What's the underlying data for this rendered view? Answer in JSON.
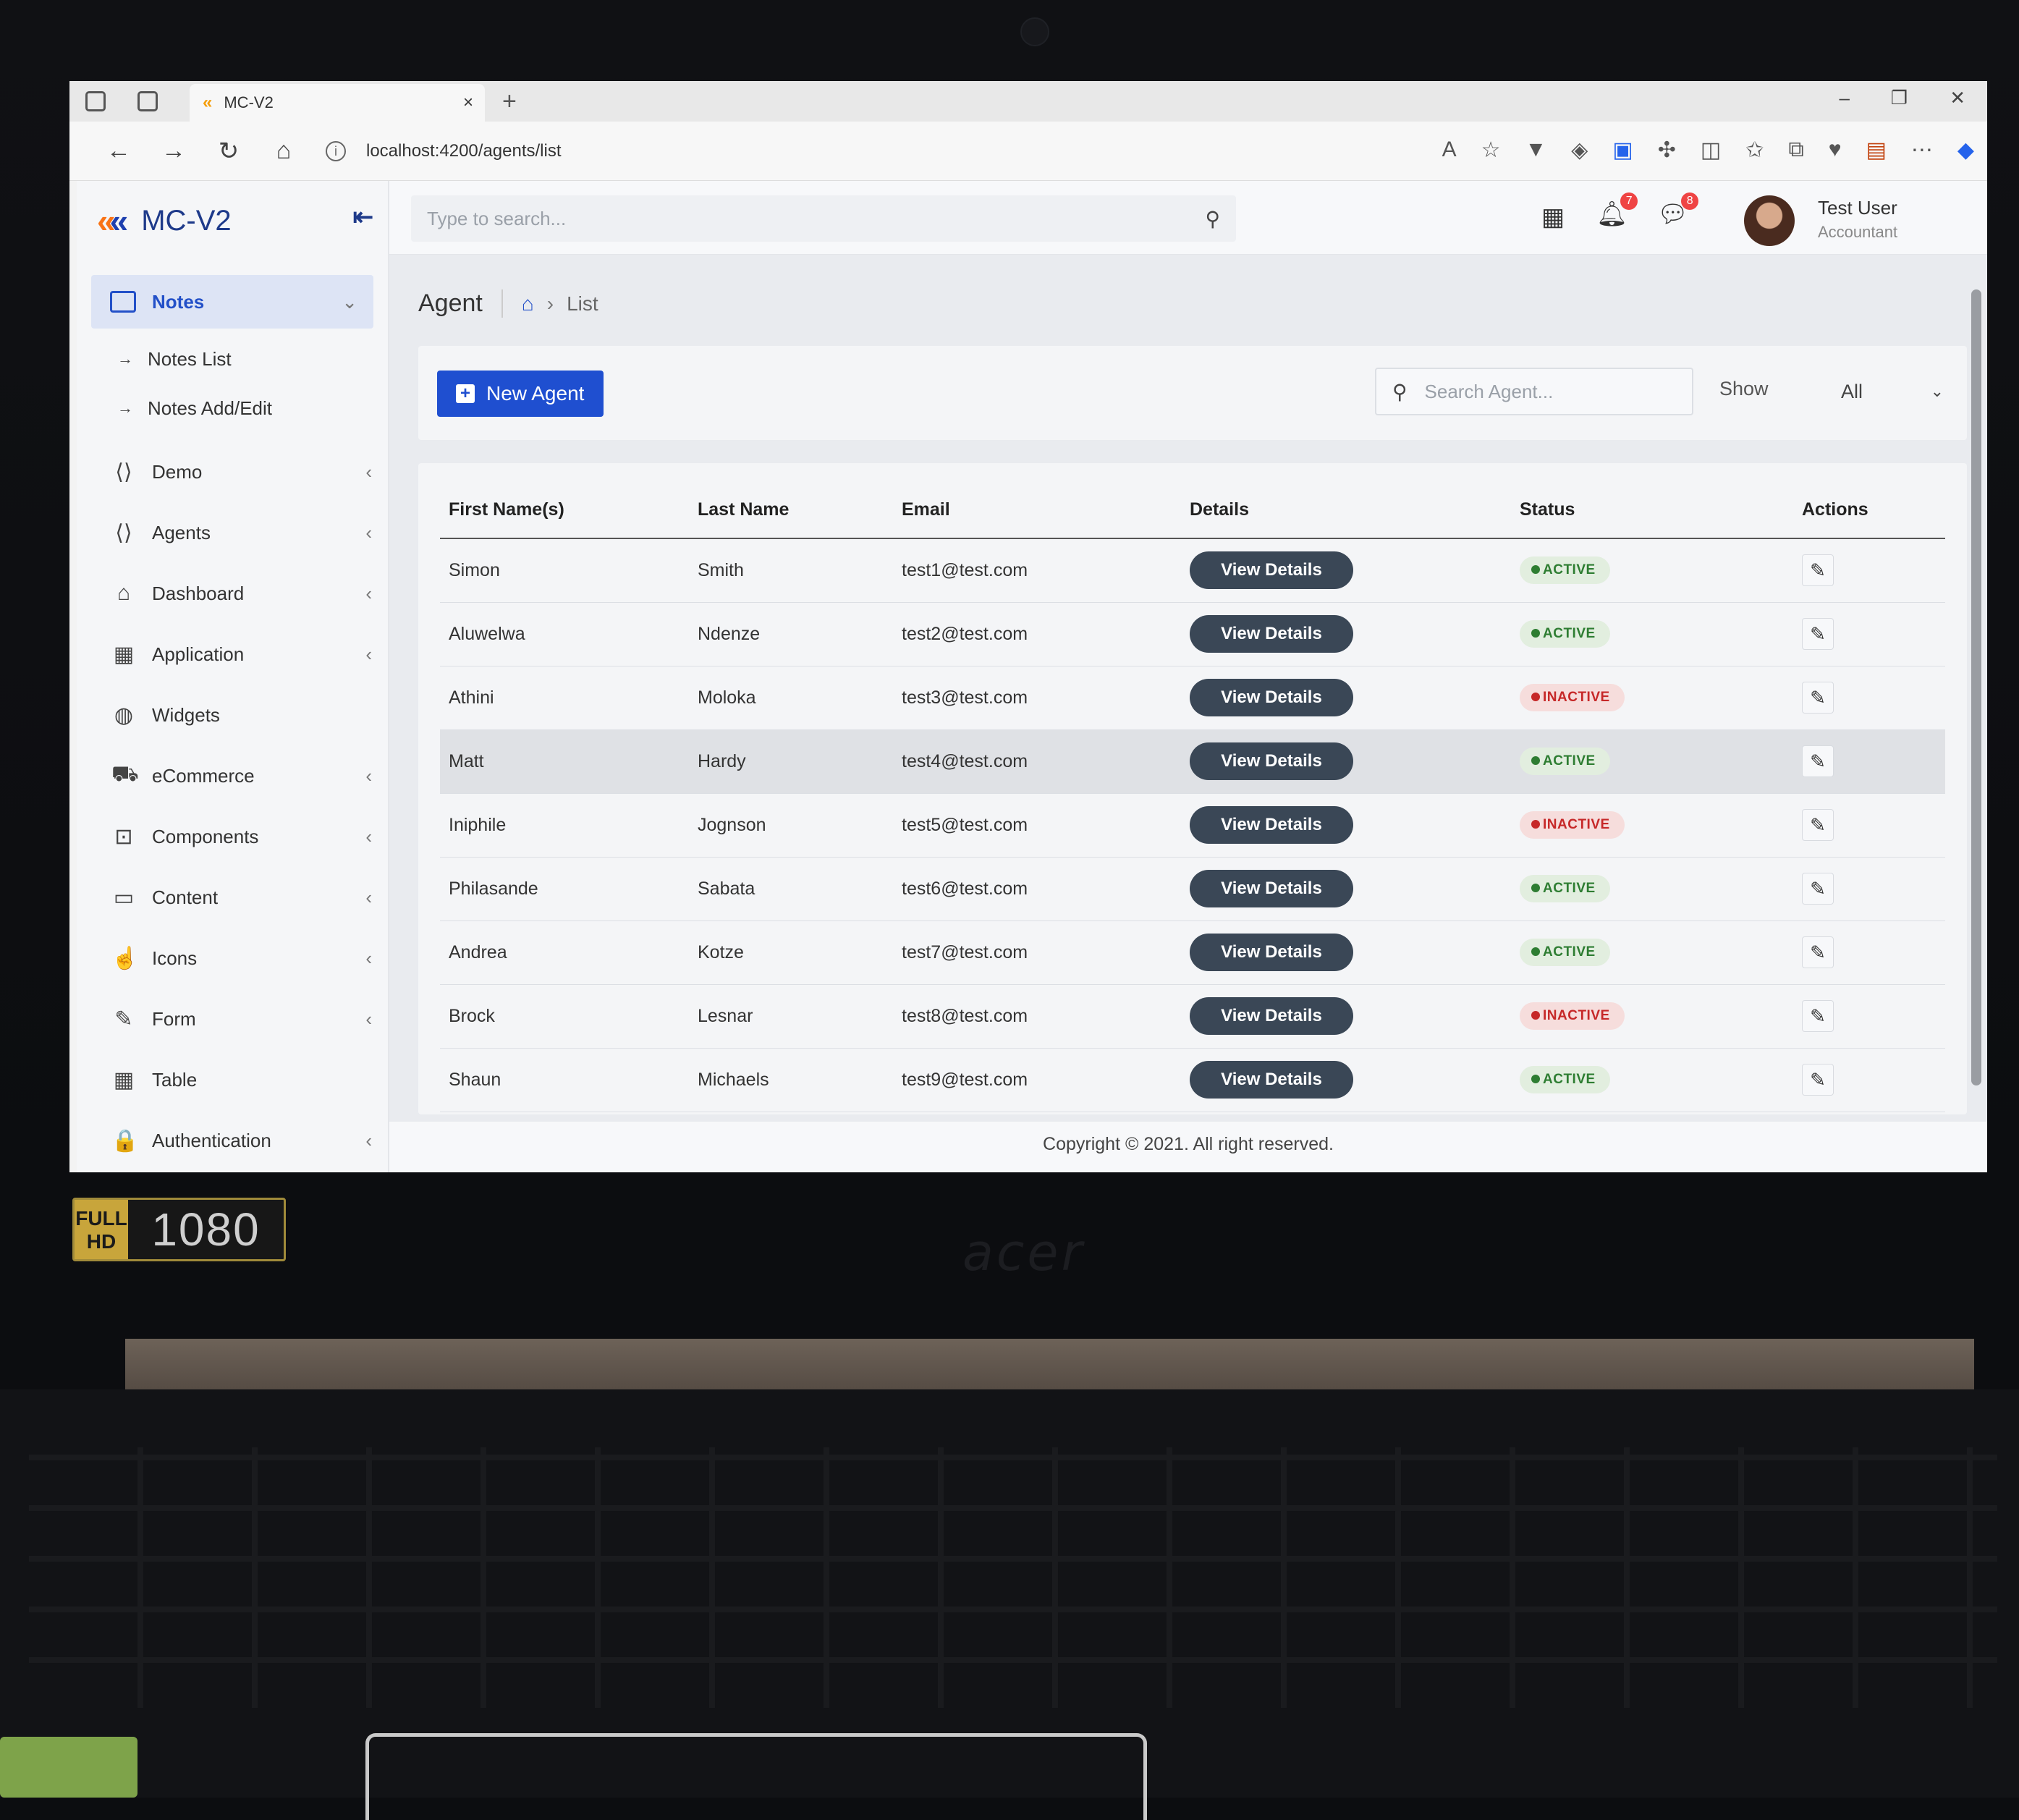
{
  "browser": {
    "tab_title": "MC-V2",
    "tab_close": "×",
    "new_tab": "+",
    "url": "localhost:4200/agents/list",
    "nav": {
      "back": "←",
      "forward": "→",
      "reload": "↻",
      "home": "⌂"
    }
  },
  "app": {
    "brand": "MC-V2",
    "brand_icon": "chevron-logo-icon",
    "collapse_icon": "collapse-left-icon"
  },
  "sidebar": {
    "active": {
      "label": "Notes",
      "chevron": "⌄"
    },
    "sub_items": [
      {
        "label": "Notes List",
        "arrow": "→"
      },
      {
        "label": "Notes Add/Edit",
        "arrow": "→"
      }
    ],
    "items": [
      {
        "label": "Demo",
        "icon": "code-icon",
        "glyph": "⟨⟩",
        "chevron": "‹"
      },
      {
        "label": "Agents",
        "icon": "code-icon",
        "glyph": "⟨⟩",
        "chevron": "‹"
      },
      {
        "label": "Dashboard",
        "icon": "home-icon",
        "glyph": "⌂",
        "chevron": "‹"
      },
      {
        "label": "Application",
        "icon": "grid-icon",
        "glyph": "▦",
        "chevron": "‹"
      },
      {
        "label": "Widgets",
        "icon": "palette-icon",
        "glyph": "◍",
        "chevron": ""
      },
      {
        "label": "eCommerce",
        "icon": "cart-icon",
        "glyph": "⛟",
        "chevron": "‹"
      },
      {
        "label": "Components",
        "icon": "bookmark-icon",
        "glyph": "⊡",
        "chevron": "‹"
      },
      {
        "label": "Content",
        "icon": "folder-icon",
        "glyph": "▭",
        "chevron": "‹"
      },
      {
        "label": "Icons",
        "icon": "hand-icon",
        "glyph": "☝",
        "chevron": "‹"
      },
      {
        "label": "Form",
        "icon": "edit-icon",
        "glyph": "✎",
        "chevron": "‹"
      },
      {
        "label": "Table",
        "icon": "table-icon",
        "glyph": "▦",
        "chevron": ""
      },
      {
        "label": "Authentication",
        "icon": "lock-icon",
        "glyph": "🔒",
        "chevron": "‹"
      }
    ]
  },
  "topbar": {
    "search_placeholder": "Type to search...",
    "notifications_count": "7",
    "messages_count": "8",
    "user_name": "Test User",
    "user_role": "Accountant"
  },
  "page": {
    "title": "Agent",
    "breadcrumb_current": "List",
    "new_button": "New Agent",
    "search_placeholder": "Search Agent...",
    "show_label": "Show",
    "show_value": "All"
  },
  "table": {
    "headers": [
      "First Name(s)",
      "Last Name",
      "Email",
      "Details",
      "Status",
      "Actions"
    ],
    "view_label": "View Details",
    "rows": [
      {
        "first": "Simon",
        "last": "Smith",
        "email": "test1@test.com",
        "status": "ACTIVE"
      },
      {
        "first": "Aluwelwa",
        "last": "Ndenze",
        "email": "test2@test.com",
        "status": "ACTIVE"
      },
      {
        "first": "Athini",
        "last": "Moloka",
        "email": "test3@test.com",
        "status": "INACTIVE"
      },
      {
        "first": "Matt",
        "last": "Hardy",
        "email": "test4@test.com",
        "status": "ACTIVE"
      },
      {
        "first": "Iniphile",
        "last": "Jognson",
        "email": "test5@test.com",
        "status": "INACTIVE"
      },
      {
        "first": "Philasande",
        "last": "Sabata",
        "email": "test6@test.com",
        "status": "ACTIVE"
      },
      {
        "first": "Andrea",
        "last": "Kotze",
        "email": "test7@test.com",
        "status": "ACTIVE"
      },
      {
        "first": "Brock",
        "last": "Lesnar",
        "email": "test8@test.com",
        "status": "INACTIVE"
      },
      {
        "first": "Shaun",
        "last": "Michaels",
        "email": "test9@test.com",
        "status": "ACTIVE"
      }
    ]
  },
  "footer": {
    "text": "Copyright © 2021. All right reserved."
  },
  "device": {
    "hd_full": "FULL HD",
    "hd_res": "1080"
  },
  "colors": {
    "accent": "#1f4fd0",
    "active": "#2e7d32",
    "inactive": "#c62828",
    "button_dark": "#3a4756"
  }
}
